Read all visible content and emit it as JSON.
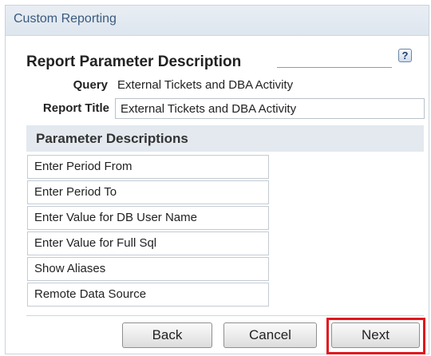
{
  "window": {
    "title": "Custom Reporting"
  },
  "section": {
    "title": "Report Parameter Description",
    "help_icon_glyph": "?"
  },
  "fields": {
    "query_label": "Query",
    "query_value": "External Tickets and DBA Activity",
    "report_title_label": "Report Title",
    "report_title_value": "External Tickets and DBA Activity"
  },
  "parameters": {
    "header": "Parameter Descriptions",
    "items": [
      "Enter Period From",
      "Enter Period To",
      "Enter Value for DB User Name",
      "Enter Value for Full Sql",
      "Show Aliases",
      "Remote Data Source"
    ]
  },
  "buttons": {
    "back": "Back",
    "cancel": "Cancel",
    "next": "Next"
  },
  "colors": {
    "title_text": "#3a5a7e",
    "highlight": "#e0161e"
  }
}
